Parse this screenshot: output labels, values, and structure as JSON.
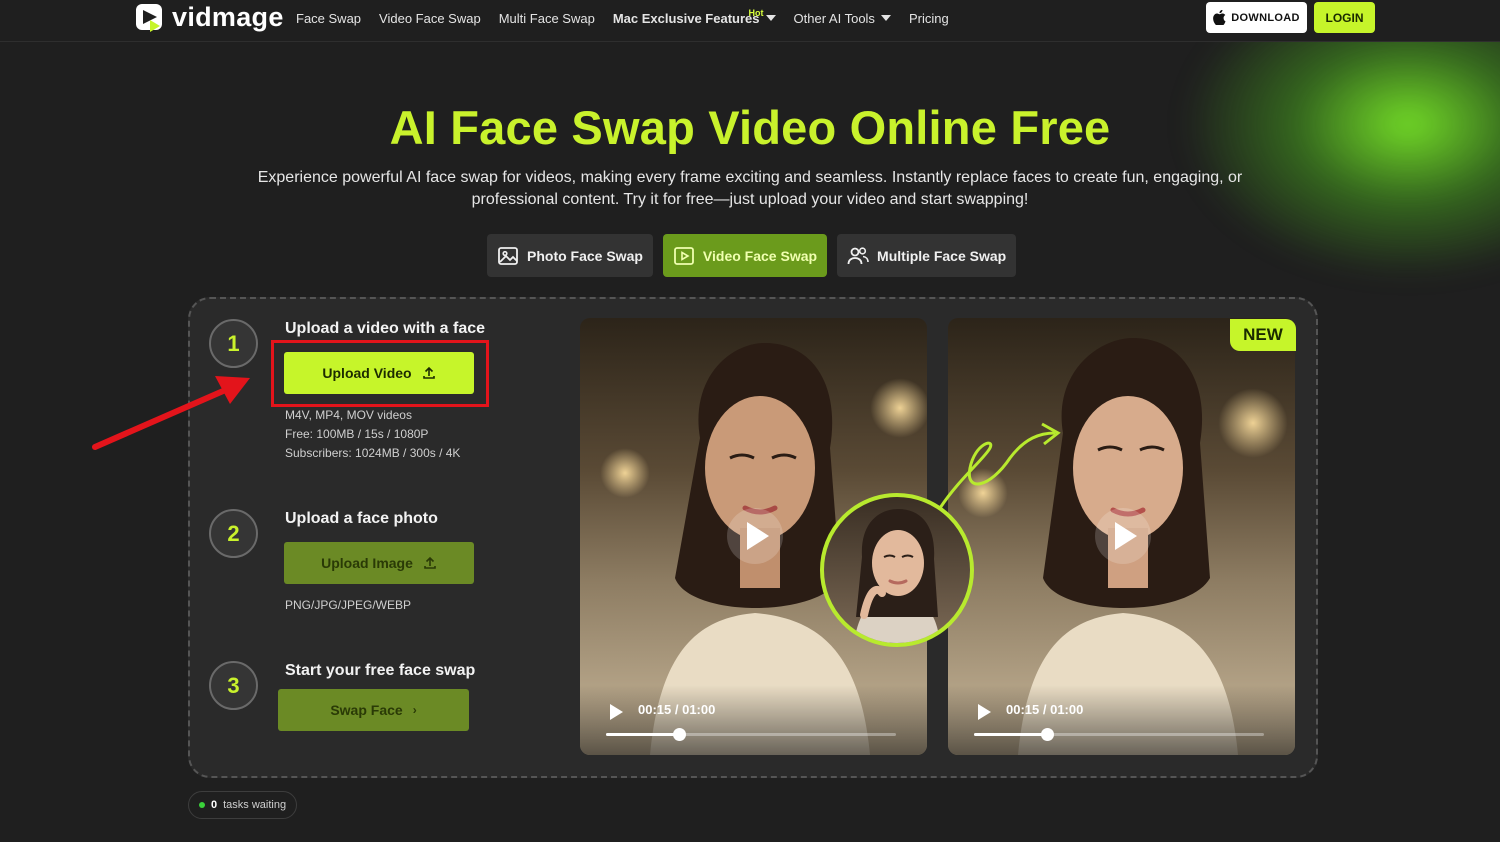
{
  "brand": {
    "name": "vidmage"
  },
  "nav": {
    "links": [
      "Face Swap",
      "Video Face Swap",
      "Multi Face Swap",
      "Mac Exclusive Features",
      "Other AI Tools",
      "Pricing"
    ],
    "hot_badge": "Hot",
    "download_label": "DOWNLOAD",
    "login_label": "LOGIN"
  },
  "hero": {
    "title": "AI Face Swap Video Online Free",
    "subtitle": "Experience powerful AI face swap for videos, making every frame exciting and seamless. Instantly replace faces to create fun, engaging, or professional content. Try it for free—just upload your video and start swapping!"
  },
  "tabs": [
    {
      "label": "Photo Face Swap",
      "icon": "image-icon",
      "active": false
    },
    {
      "label": "Video Face Swap",
      "icon": "video-play-icon",
      "active": true
    },
    {
      "label": "Multiple Face Swap",
      "icon": "users-icon",
      "active": false
    }
  ],
  "steps": [
    {
      "num": "1",
      "title": "Upload a video with a face",
      "button": "Upload Video",
      "notes": [
        "M4V, MP4, MOV videos",
        "Free: 100MB / 15s / 1080P",
        "Subscribers: 1024MB / 300s / 4K"
      ]
    },
    {
      "num": "2",
      "title": "Upload a face photo",
      "button": "Upload Image",
      "notes": [
        "PNG/JPG/JPEG/WEBP"
      ]
    },
    {
      "num": "3",
      "title": "Start your free face swap",
      "button": "Swap Face"
    }
  ],
  "preview": {
    "new_badge": "NEW",
    "videos": [
      {
        "time": "00:15 / 01:00",
        "progress": 0.25
      },
      {
        "time": "00:15 / 01:00",
        "progress": 0.25
      }
    ]
  },
  "status": {
    "count": "0",
    "label": "tasks waiting"
  },
  "colors": {
    "accent": "#c6f52a",
    "background": "#1f1f1f",
    "highlight_box": "#e3141b"
  }
}
